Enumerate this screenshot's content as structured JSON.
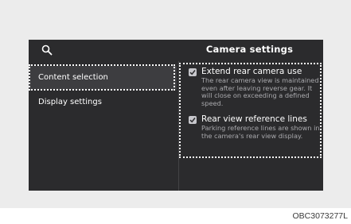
{
  "header": {
    "title": "Camera settings",
    "search_icon": "search-icon"
  },
  "sidebar": {
    "items": [
      {
        "label": "Content selection",
        "selected": true
      },
      {
        "label": "Display settings",
        "selected": false
      }
    ]
  },
  "options": [
    {
      "label": "Extend rear camera use",
      "checked": true,
      "description": "The rear camera view is maintained even after leaving reverse gear. It will close on exceeding a defined speed."
    },
    {
      "label": "Rear view reference lines",
      "checked": true,
      "description": "Parking reference lines are shown in the camera's rear view display."
    }
  ],
  "figure_code": "OBC3073277L",
  "colors": {
    "screen_bg": "#2b2b2d",
    "selected_bg": "#3d3d40",
    "text": "#ffffff",
    "desc_text": "#a9a9ad",
    "checkbox": "#c7c7cc"
  }
}
